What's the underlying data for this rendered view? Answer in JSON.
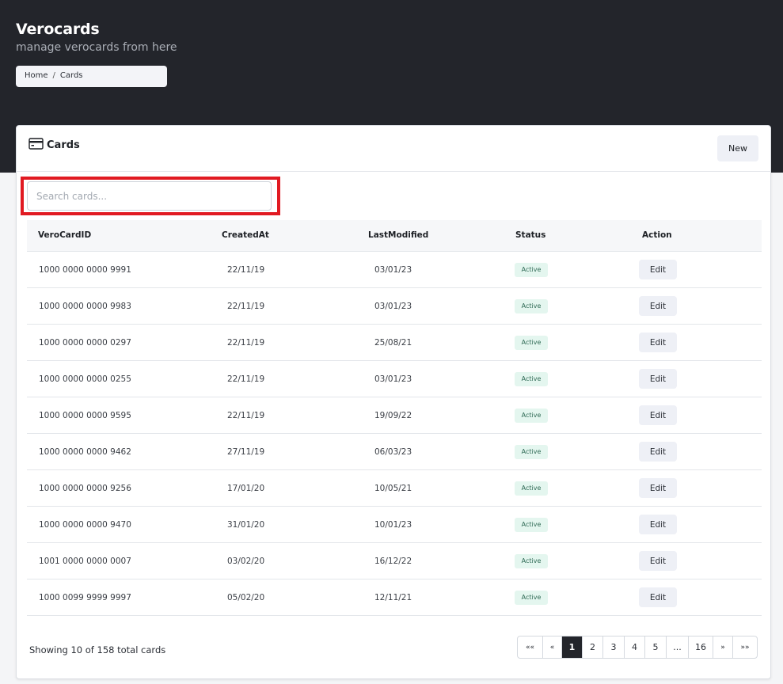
{
  "header": {
    "title": "Verocards",
    "subtitle": "manage verocards from here",
    "breadcrumb": [
      "Home",
      "Cards"
    ],
    "breadcrumb_separator": "/"
  },
  "card": {
    "title": "Cards",
    "new_label": "New",
    "icon": "credit-card-icon"
  },
  "search": {
    "placeholder": "Search cards...",
    "value": ""
  },
  "table": {
    "columns": [
      "VeroCardID",
      "CreatedAt",
      "LastModified",
      "Status",
      "Action"
    ],
    "rows": [
      {
        "id": "1000 0000 0000 9991",
        "created": "22/11/19",
        "modified": "03/01/23",
        "status": "Active",
        "action": "Edit"
      },
      {
        "id": "1000 0000 0000 9983",
        "created": "22/11/19",
        "modified": "03/01/23",
        "status": "Active",
        "action": "Edit"
      },
      {
        "id": "1000 0000 0000 0297",
        "created": "22/11/19",
        "modified": "25/08/21",
        "status": "Active",
        "action": "Edit"
      },
      {
        "id": "1000 0000 0000 0255",
        "created": "22/11/19",
        "modified": "03/01/23",
        "status": "Active",
        "action": "Edit"
      },
      {
        "id": "1000 0000 0000 9595",
        "created": "22/11/19",
        "modified": "19/09/22",
        "status": "Active",
        "action": "Edit"
      },
      {
        "id": "1000 0000 0000 9462",
        "created": "27/11/19",
        "modified": "06/03/23",
        "status": "Active",
        "action": "Edit"
      },
      {
        "id": "1000 0000 0000 9256",
        "created": "17/01/20",
        "modified": "10/05/21",
        "status": "Active",
        "action": "Edit"
      },
      {
        "id": "1000 0000 0000 9470",
        "created": "31/01/20",
        "modified": "10/01/23",
        "status": "Active",
        "action": "Edit"
      },
      {
        "id": "1001 0000 0000 0007",
        "created": "03/02/20",
        "modified": "16/12/22",
        "status": "Active",
        "action": "Edit"
      },
      {
        "id": "1000 0099 9999 9997",
        "created": "05/02/20",
        "modified": "12/11/21",
        "status": "Active",
        "action": "Edit"
      }
    ]
  },
  "footer": {
    "showing_text": "Showing 10 of 158 total cards"
  },
  "pagination": {
    "items": [
      "««",
      "«",
      "1",
      "2",
      "3",
      "4",
      "5",
      "...",
      "16",
      "»",
      "»»"
    ],
    "current": "1"
  },
  "colors": {
    "hero_bg": "#23252b",
    "highlight_border": "#e11a22",
    "badge_bg": "#e4f6ef",
    "badge_text": "#2f6a55",
    "button_bg": "#eef0f6"
  }
}
